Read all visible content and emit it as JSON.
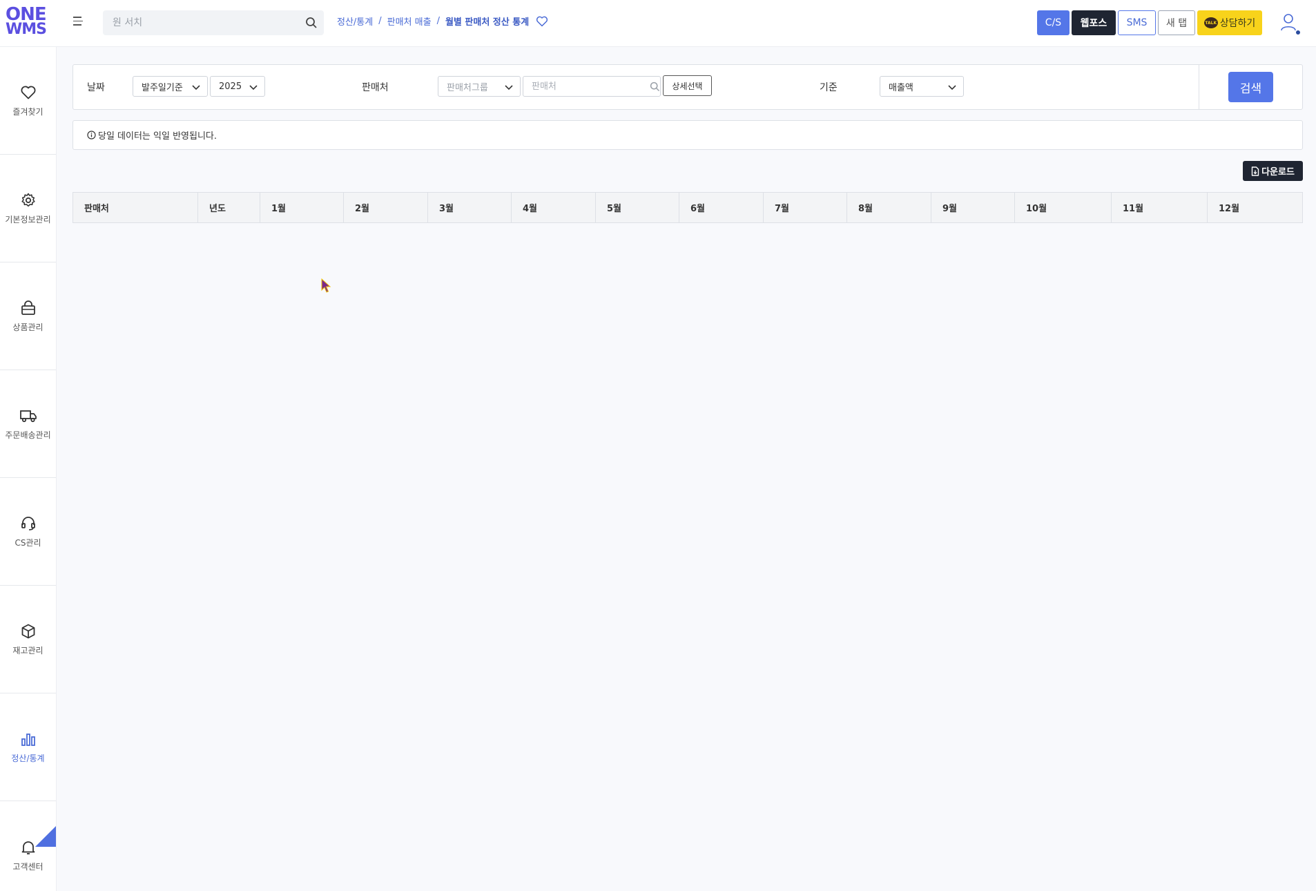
{
  "header": {
    "logo_line1": "ONE",
    "logo_line2": "WMS",
    "search_placeholder": "원 서치",
    "breadcrumb": [
      "정산/통계",
      "판매처 매출",
      "월별 판매처 정산 통계"
    ],
    "buttons": {
      "cs": "C/S",
      "webpos": "웹포스",
      "sms": "SMS",
      "newtab": "새 탭",
      "talk": "상담하기",
      "talk_icon_text": "TALK"
    }
  },
  "sidebar": {
    "items": [
      {
        "label": "즐겨찾기",
        "icon": "heart-icon"
      },
      {
        "label": "기본정보관리",
        "icon": "gear-icon"
      },
      {
        "label": "상품관리",
        "icon": "bag-icon"
      },
      {
        "label": "주문배송관리",
        "icon": "truck-icon"
      },
      {
        "label": "CS관리",
        "icon": "headset-icon"
      },
      {
        "label": "재고관리",
        "icon": "box-icon"
      },
      {
        "label": "정산/통계",
        "icon": "bar-chart-icon",
        "active": true
      },
      {
        "label": "고객센터",
        "icon": "bell-icon"
      }
    ]
  },
  "filters": {
    "date_label": "날짜",
    "date_basis": "발주일기준",
    "year": "2025",
    "vendor_label": "판매처",
    "vendor_group_placeholder": "판매처그룹",
    "vendor_placeholder": "판매처",
    "detail_button": "상세선택",
    "criteria_label": "기준",
    "criteria_value": "매출액",
    "search_button": "검색"
  },
  "notice": "당일 데이터는 익일 반영됩니다.",
  "download_button": "다운로드",
  "table": {
    "columns": [
      "판매처",
      "년도",
      "1월",
      "2월",
      "3월",
      "4월",
      "5월",
      "6월",
      "7월",
      "8월",
      "9월",
      "10월",
      "11월",
      "12월"
    ]
  },
  "colors": {
    "primary": "#5476e8",
    "dark": "#1f2532",
    "kakao": "#f8d31b",
    "logo": "#5b4fe0"
  }
}
